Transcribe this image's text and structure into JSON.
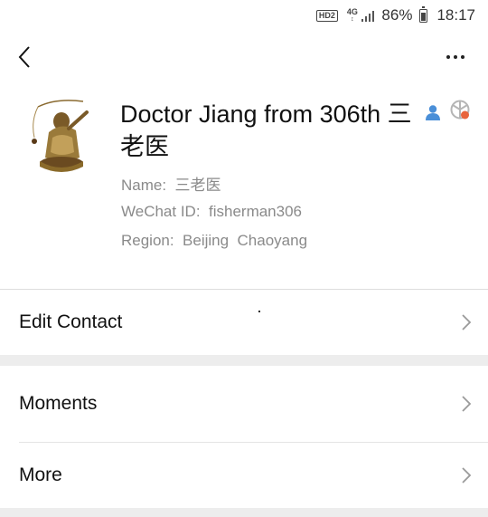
{
  "status_bar": {
    "hd_label": "HD2",
    "network_label": "4G",
    "battery_percent": "86%",
    "battery_level": 0.86,
    "time": "18:17"
  },
  "nav": {
    "back_icon": "chevron-left-icon",
    "more_icon": "more-dots-icon"
  },
  "profile": {
    "display_name": "Doctor Jiang from 306th 三老医",
    "name_line": "Name:  三老医",
    "wechat_id_line": "WeChat ID:  fisherman306",
    "region_line": "Region:  Beijing  Chaoyang",
    "badges": [
      "contact-person-icon",
      "moments-camera-icon"
    ]
  },
  "rows": [
    {
      "label": "Edit Contact"
    },
    {
      "label": "Moments"
    },
    {
      "label": "More"
    }
  ],
  "colors": {
    "secondary_text": "#8a8a8a",
    "section_gap": "#ededed",
    "contact_icon": "#4a8fd8",
    "moments_accent": "#e8643c"
  }
}
